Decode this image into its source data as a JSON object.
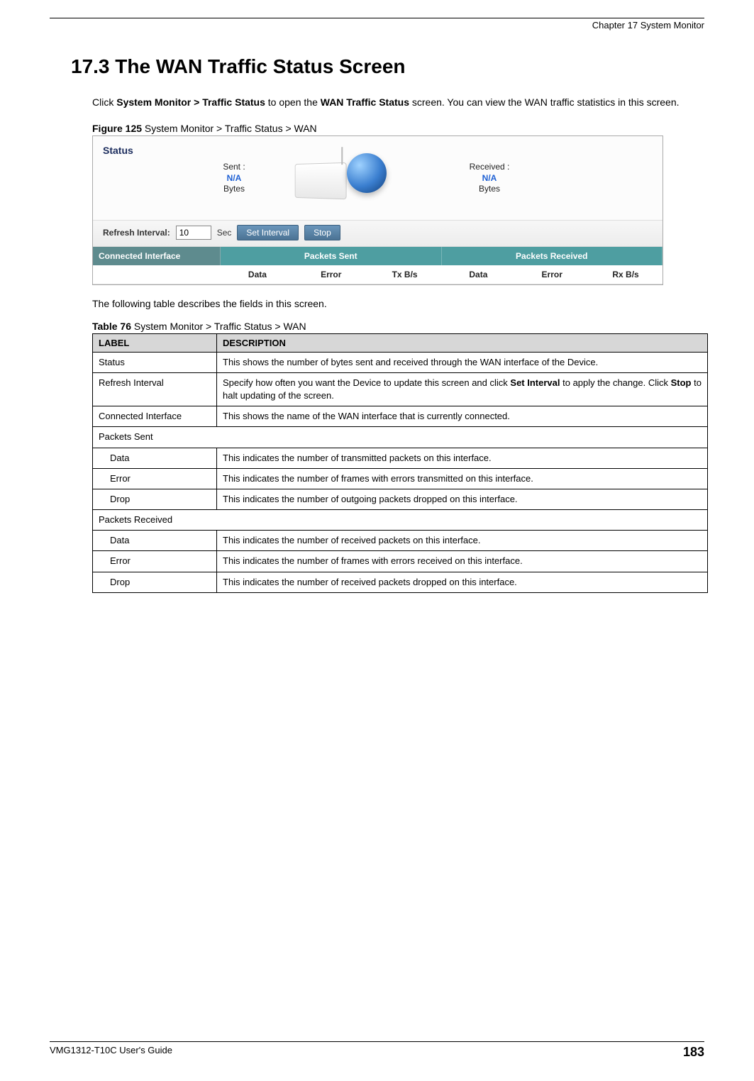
{
  "header": {
    "chapter": "Chapter 17 System Monitor"
  },
  "heading": "17.3  The WAN Traffic Status Screen",
  "intro": {
    "pre": "Click ",
    "boldpath": "System Monitor > Traffic Status",
    "mid": " to open the ",
    "boldname": "WAN Traffic Status",
    "post": " screen. You can view the WAN traffic statistics in this screen."
  },
  "figure": {
    "label_bold": "Figure 125",
    "label_rest": "   System Monitor > Traffic Status > WAN"
  },
  "screenshot": {
    "status_label": "Status",
    "sent": {
      "title": "Sent :",
      "value": "N/A",
      "unit": "Bytes"
    },
    "received": {
      "title": "Received :",
      "value": "N/A",
      "unit": "Bytes"
    },
    "refresh_label": "Refresh Interval:",
    "refresh_value": "10",
    "refresh_unit": "Sec",
    "btn_set": "Set Interval",
    "btn_stop": "Stop",
    "hdr_connected": "Connected Interface",
    "hdr_sent": "Packets Sent",
    "hdr_recv": "Packets Received",
    "sub": {
      "data": "Data",
      "error": "Error",
      "txbs": "Tx B/s",
      "rxbs": "Rx B/s"
    }
  },
  "between": "The following table describes the fields in this screen.",
  "table_caption": {
    "bold": "Table 76",
    "rest": "   System Monitor > Traffic Status > WAN"
  },
  "table": {
    "head_label": "LABEL",
    "head_desc": "DESCRIPTION",
    "rows": {
      "status": {
        "label": "Status",
        "desc": "This shows the number of bytes sent and received through the WAN interface of the Device."
      },
      "refresh": {
        "label": "Refresh Interval",
        "desc_pre": "Specify how often you want the Device to update this screen and click ",
        "bold1": "Set Interval",
        "mid": " to apply the change. Click ",
        "bold2": "Stop",
        "post": " to halt updating of the screen."
      },
      "conn": {
        "label": "Connected Interface",
        "desc": "This shows the name of the WAN interface that is currently connected."
      },
      "psent": {
        "label": "Packets Sent"
      },
      "psent_data": {
        "label": "Data",
        "desc": "This indicates the number of transmitted packets on this interface."
      },
      "psent_error": {
        "label": "Error",
        "desc": "This indicates the number of frames with errors transmitted on this interface."
      },
      "psent_drop": {
        "label": "Drop",
        "desc": "This indicates the number of outgoing packets dropped on this interface."
      },
      "precv": {
        "label": "Packets Received"
      },
      "precv_data": {
        "label": "Data",
        "desc": "This indicates the number of received packets on this interface."
      },
      "precv_error": {
        "label": "Error",
        "desc": "This indicates the number of frames with errors received on this interface."
      },
      "precv_drop": {
        "label": "Drop",
        "desc": "This indicates the number of received packets dropped on this interface."
      }
    }
  },
  "footer": {
    "guide": "VMG1312-T10C User's Guide",
    "page": "183"
  }
}
